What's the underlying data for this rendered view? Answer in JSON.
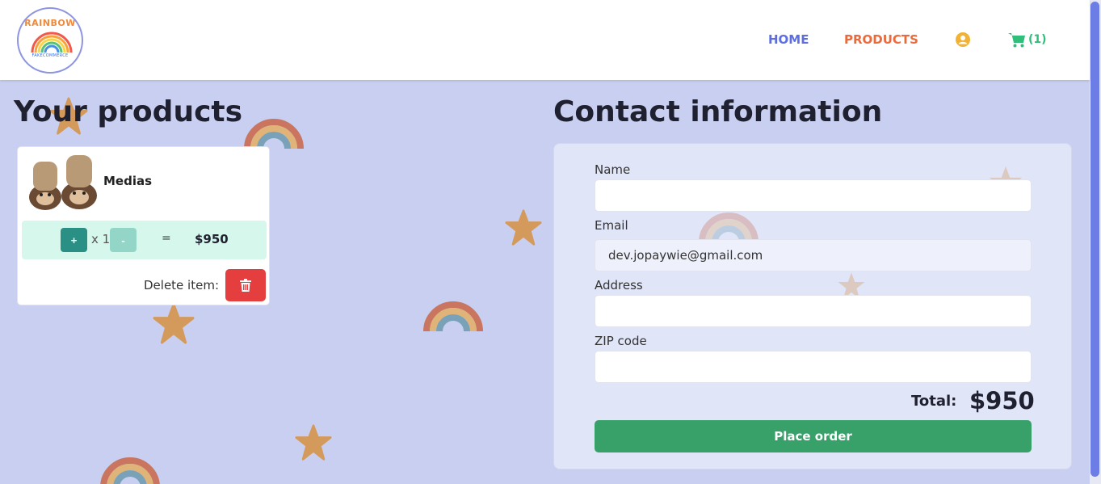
{
  "brand": {
    "logo_top_text": "RAINBOW",
    "logo_bottom_text": "FAKECOMMERCE"
  },
  "nav": {
    "home": "HOME",
    "products": "PRODUCTS",
    "cart_count": "(1)"
  },
  "cart_section": {
    "title": "Your products",
    "items": [
      {
        "name": "Medias",
        "plus_label": "+",
        "quantity": "x 1",
        "minus_label": "-",
        "equals": "=",
        "total": "$950",
        "delete_label": "Delete item:"
      }
    ]
  },
  "contact": {
    "title": "Contact information",
    "name_label": "Name",
    "name_value": "",
    "email_label": "Email",
    "email_value": "dev.jopaywie@gmail.com",
    "address_label": "Address",
    "address_value": "",
    "zip_label": "ZIP code",
    "zip_value": "",
    "total_label": "Total:",
    "total_value": "$950",
    "place_order_label": "Place order"
  },
  "colors": {
    "background": "#c8cff0",
    "nav_home": "#5c6ee0",
    "nav_products": "#ea6a3c",
    "cart": "#2fbf7a",
    "delete": "#e53e3e",
    "order": "#38a169"
  }
}
